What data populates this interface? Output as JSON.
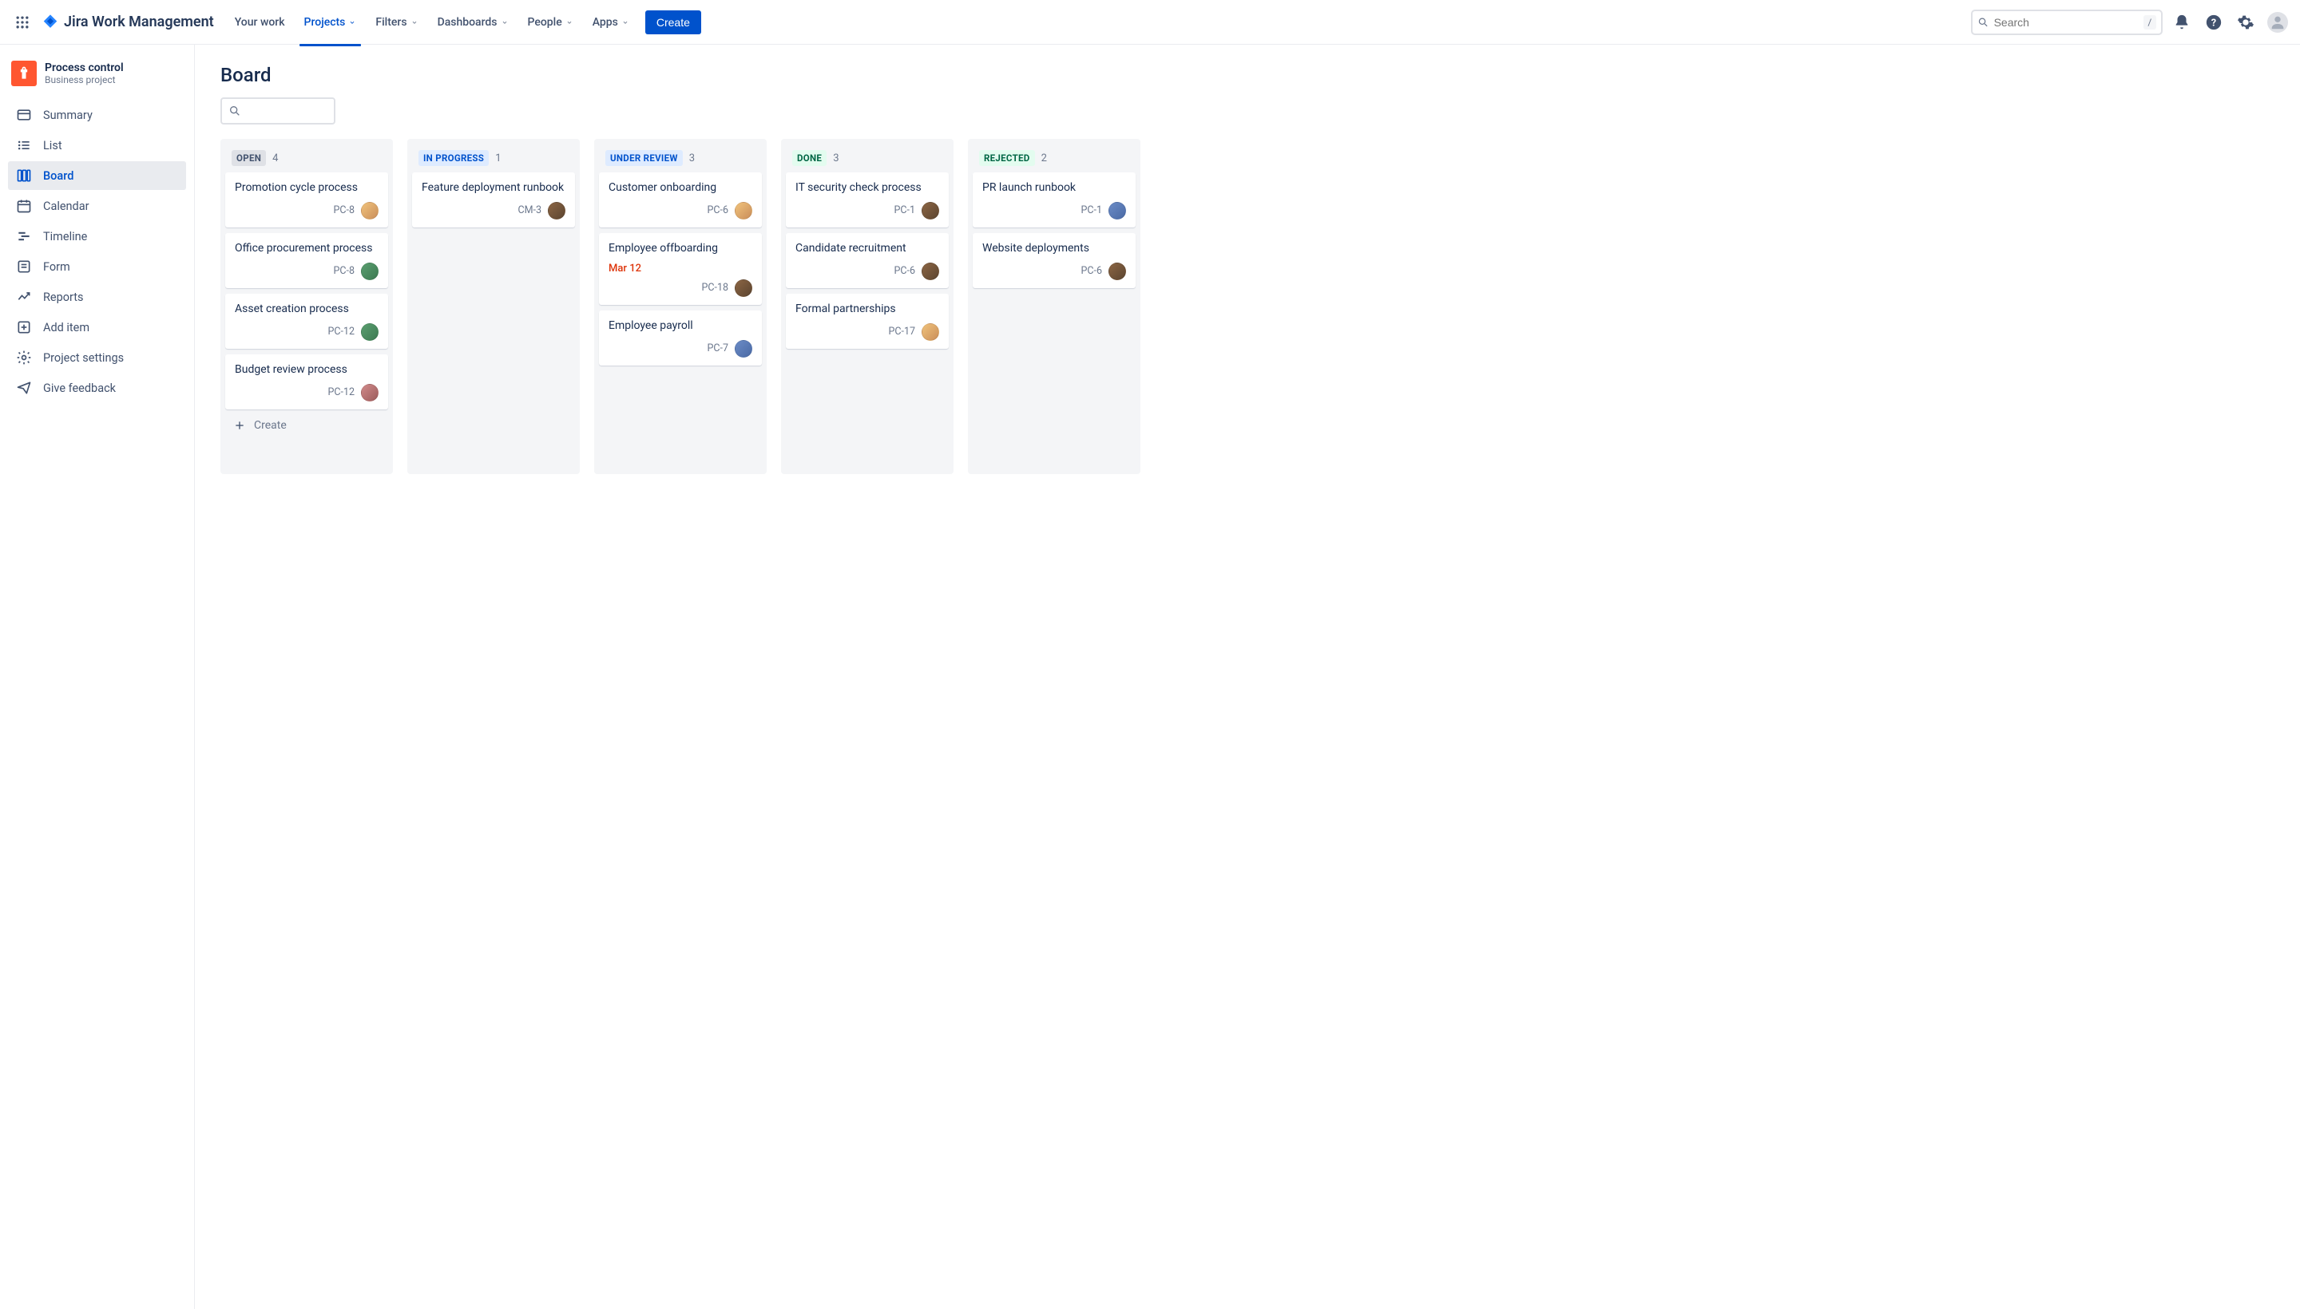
{
  "nav": {
    "brand": "Jira Work Management",
    "items": [
      "Your work",
      "Projects",
      "Filters",
      "Dashboards",
      "People",
      "Apps"
    ],
    "create": "Create",
    "search_placeholder": "Search",
    "slash": "/"
  },
  "project": {
    "name": "Process control",
    "subtitle": "Business project"
  },
  "sidebar": {
    "items": [
      {
        "label": "Summary"
      },
      {
        "label": "List"
      },
      {
        "label": "Board"
      },
      {
        "label": "Calendar"
      },
      {
        "label": "Timeline"
      },
      {
        "label": "Form"
      },
      {
        "label": "Reports"
      },
      {
        "label": "Add item"
      },
      {
        "label": "Project settings"
      },
      {
        "label": "Give feedback"
      }
    ]
  },
  "page": {
    "title": "Board",
    "create_label": "Create"
  },
  "columns": [
    {
      "key": "open",
      "label": "OPEN",
      "count": 4,
      "cards": [
        {
          "title": "Promotion cycle process",
          "key": "PC-8",
          "av": "av1"
        },
        {
          "title": "Office procurement process",
          "key": "PC-8",
          "av": "av2"
        },
        {
          "title": "Asset creation process",
          "key": "PC-12",
          "av": "av2"
        },
        {
          "title": "Budget review process",
          "key": "PC-12",
          "av": "av4"
        }
      ],
      "showCreate": true
    },
    {
      "key": "inprogress",
      "label": "IN PROGRESS",
      "count": 1,
      "cards": [
        {
          "title": "Feature deployment runbook",
          "key": "CM-3",
          "av": "av3"
        }
      ]
    },
    {
      "key": "underreview",
      "label": "UNDER REVIEW",
      "count": 3,
      "cards": [
        {
          "title": "Customer onboarding",
          "key": "PC-6",
          "av": "av1"
        },
        {
          "title": "Employee offboarding",
          "due": "Mar 12",
          "key": "PC-18",
          "av": "av3"
        },
        {
          "title": "Employee payroll",
          "key": "PC-7",
          "av": "av5"
        }
      ]
    },
    {
      "key": "done",
      "label": "DONE",
      "count": 3,
      "cards": [
        {
          "title": "IT security check process",
          "key": "PC-1",
          "av": "av3"
        },
        {
          "title": "Candidate recruitment",
          "key": "PC-6",
          "av": "av3"
        },
        {
          "title": "Formal partnerships",
          "key": "PC-17",
          "av": "av1"
        }
      ]
    },
    {
      "key": "rejected",
      "label": "REJECTED",
      "count": 2,
      "cards": [
        {
          "title": "PR launch runbook",
          "key": "PC-1",
          "av": "av5"
        },
        {
          "title": "Website deployments",
          "key": "PC-6",
          "av": "av3"
        }
      ]
    }
  ]
}
